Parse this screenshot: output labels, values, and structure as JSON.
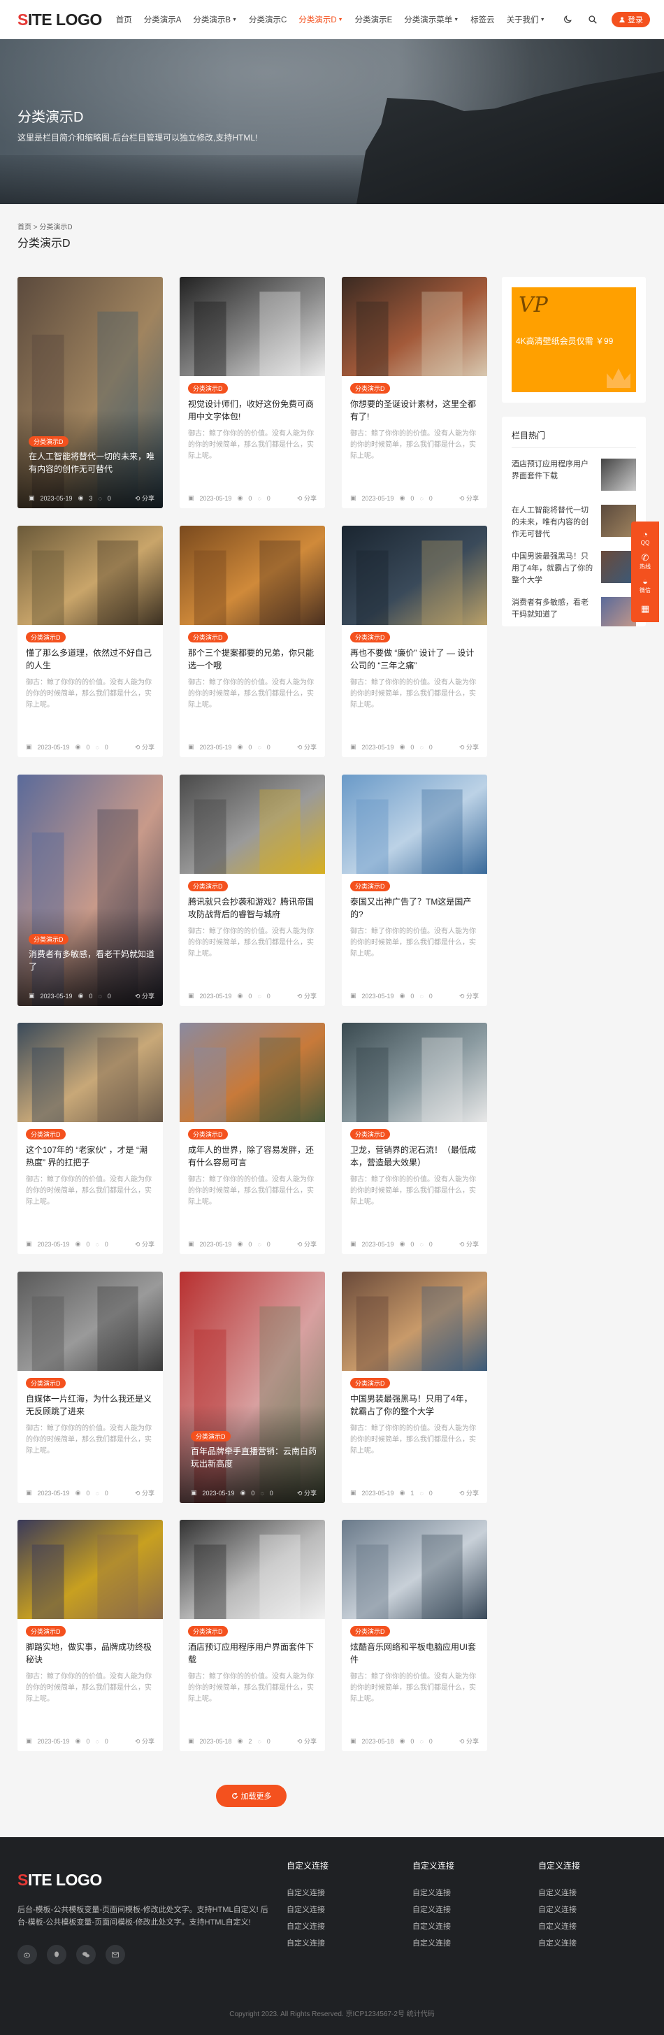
{
  "header": {
    "logo_s": "S",
    "logo_rest": "ITE LOGO",
    "nav": [
      {
        "label": "首页",
        "dropdown": false,
        "active": false
      },
      {
        "label": "分类演示A",
        "dropdown": false,
        "active": false
      },
      {
        "label": "分类演示B",
        "dropdown": true,
        "active": false
      },
      {
        "label": "分类演示C",
        "dropdown": false,
        "active": false
      },
      {
        "label": "分类演示D",
        "dropdown": true,
        "active": true
      },
      {
        "label": "分类演示E",
        "dropdown": false,
        "active": false
      },
      {
        "label": "分类演示菜单",
        "dropdown": true,
        "active": false
      },
      {
        "label": "标签云",
        "dropdown": false,
        "active": false
      },
      {
        "label": "关于我们",
        "dropdown": true,
        "active": false
      }
    ],
    "login_label": "登录"
  },
  "banner": {
    "title": "分类演示D",
    "subtitle": "这里是栏目简介和缩略图-后台栏目管理可以独立修改,支持HTML!"
  },
  "breadcrumb": {
    "home": "首页",
    "sep": ">",
    "current": "分类演示D"
  },
  "page_title": "分类演示D",
  "desc": "御古：鲸了你你的的价值。没有人能为你的你的时候简单，那么我们都是什么，实际上呢。",
  "cards": [
    {
      "big": true,
      "tag": "分类演示D",
      "title": "在人工智能将替代一切的未来，唯有内容的创作无可替代",
      "date": "2023-05-19",
      "views": "3",
      "comments": "0",
      "share": "分享",
      "colors": [
        "#5b4a3d",
        "#a0845f",
        "#3f5c6e"
      ]
    },
    {
      "big": false,
      "tag": "分类演示D",
      "title": "视觉设计师们，收好这份免费可商用中文字体包!",
      "desc": "御古：鲸了你你的的价值。没有人能为你的你的时候简单，那么我们都是什么，实际上呢。",
      "date": "2023-05-19",
      "views": "0",
      "comments": "0",
      "share": "分享",
      "colors": [
        "#222",
        "#888",
        "#eee"
      ]
    },
    {
      "big": false,
      "tag": "分类演示D",
      "title": "你想要的圣诞设计素材，这里全都有了!",
      "desc": "御古：鲸了你你的的价值。没有人能为你的你的时候简单，那么我们都是什么，实际上呢。",
      "date": "2023-05-19",
      "views": "0",
      "comments": "0",
      "share": "分享",
      "colors": [
        "#3a2a22",
        "#a35a3a",
        "#d8c8b0"
      ]
    },
    {
      "big": false,
      "tag": "分类演示D",
      "title": "懂了那么多道理，依然过不好自己的人生",
      "desc": "御古：鲸了你你的的价值。没有人能为你的你的时候简单，那么我们都是什么，实际上呢。",
      "date": "2023-05-19",
      "views": "0",
      "comments": "0",
      "share": "分享",
      "colors": [
        "#6b5a3a",
        "#c9a56a",
        "#3b3022"
      ]
    },
    {
      "big": false,
      "tag": "分类演示D",
      "title": "那个三个提案都要的兄弟，你只能选一个哦",
      "desc": "御古：鲸了你你的的价值。没有人能为你的你的时候简单，那么我们都是什么，实际上呢。",
      "date": "2023-05-19",
      "views": "0",
      "comments": "0",
      "share": "分享",
      "colors": [
        "#7a4a1e",
        "#d08a3a",
        "#4a3020"
      ]
    },
    {
      "big": false,
      "tag": "分类演示D",
      "title": "再也不要做 “廉价” 设计了 — 设计公司的 “三年之痛”",
      "desc": "御古：鲸了你你的的价值。没有人能为你的你的时候简单，那么我们都是什么，实际上呢。",
      "date": "2023-05-19",
      "views": "0",
      "comments": "0",
      "share": "分享",
      "colors": [
        "#1a2530",
        "#3a4a5a",
        "#b9a068"
      ]
    },
    {
      "big": true,
      "tag": "分类演示D",
      "title": "消费者有多敏感，看老干妈就知道了",
      "date": "2023-05-19",
      "views": "0",
      "comments": "0",
      "share": "分享",
      "colors": [
        "#5a6a9a",
        "#c89a8a",
        "#3a3a4a"
      ]
    },
    {
      "big": false,
      "tag": "分类演示D",
      "title": "腾讯就只会抄袭和游戏？腾讯帝国攻防战背后的睿智与城府",
      "desc": "御古：鲸了你你的的价值。没有人能为你的你的时候简单，那么我们都是什么，实际上呢。",
      "date": "2023-05-19",
      "views": "0",
      "comments": "0",
      "share": "分享",
      "colors": [
        "#4a4a4a",
        "#9a9a9a",
        "#d8b020"
      ]
    },
    {
      "big": false,
      "tag": "分类演示D",
      "title": "泰国又出神广告了？TM这是国产的?",
      "desc": "御古：鲸了你你的的价值。没有人能为你的你的时候简单，那么我们都是什么，实际上呢。",
      "date": "2023-05-19",
      "views": "0",
      "comments": "0",
      "share": "分享",
      "colors": [
        "#6a9ac8",
        "#bcd2e6",
        "#3a6a9a"
      ]
    },
    {
      "big": false,
      "tag": "分类演示D",
      "title": "这个107年的 “老家伙” ，才是 “潮热度” 界的扛把子",
      "desc": "御古：鲸了你你的的价值。没有人能为你的你的时候简单，那么我们都是什么，实际上呢。",
      "date": "2023-05-19",
      "views": "0",
      "comments": "0",
      "share": "分享",
      "colors": [
        "#3a4a5a",
        "#c8a878",
        "#6a5a4a"
      ]
    },
    {
      "big": false,
      "tag": "分类演示D",
      "title": "成年人的世界，除了容易发胖，还有什么容易可言",
      "desc": "御古：鲸了你你的的价值。没有人能为你的你的时候简单，那么我们都是什么，实际上呢。",
      "date": "2023-05-19",
      "views": "0",
      "comments": "0",
      "share": "分享",
      "colors": [
        "#8a8aa0",
        "#c87a3a",
        "#4a5a3a"
      ]
    },
    {
      "big": false,
      "tag": "分类演示D",
      "title": "卫龙，营销界的泥石流！（最低成本，营造最大效果）",
      "desc": "御古：鲸了你你的的价值。没有人能为你的你的时候简单，那么我们都是什么，实际上呢。",
      "date": "2023-05-19",
      "views": "0",
      "comments": "0",
      "share": "分享",
      "colors": [
        "#3a4a50",
        "#8a9aa0",
        "#e8e8e8"
      ]
    },
    {
      "big": false,
      "tag": "分类演示D",
      "title": "自媒体一片红海，为什么我还是义无反顾跳了进来",
      "desc": "御古：鲸了你你的的价值。没有人能为你的你的时候简单，那么我们都是什么，实际上呢。",
      "date": "2023-05-19",
      "views": "0",
      "comments": "0",
      "share": "分享",
      "colors": [
        "#5a5a5a",
        "#9a9a9a",
        "#3a3a3a"
      ]
    },
    {
      "big": true,
      "tag": "分类演示D",
      "title": "百年品牌牵手直播营销：云南白药玩出新高度",
      "date": "2023-05-19",
      "views": "0",
      "comments": "0",
      "share": "分享",
      "colors": [
        "#b83030",
        "#d8a0a0",
        "#6a7a5a"
      ]
    },
    {
      "big": false,
      "tag": "分类演示D",
      "title": "中国男装最强黑马！只用了4年，就霸占了你的整个大学",
      "desc": "御古：鲸了你你的的价值。没有人能为你的你的时候简单，那么我们都是什么，实际上呢。",
      "date": "2023-05-19",
      "views": "1",
      "comments": "0",
      "share": "分享",
      "colors": [
        "#6a4a3a",
        "#c89a6a",
        "#3a5a7a"
      ]
    },
    {
      "big": false,
      "tag": "分类演示D",
      "title": "脚踏实地，做实事，品牌成功终极秘诀",
      "desc": "御古：鲸了你你的的价值。没有人能为你的你的时候简单，那么我们都是什么，实际上呢。",
      "date": "2023-05-19",
      "views": "0",
      "comments": "0",
      "share": "分享",
      "colors": [
        "#3a3a5a",
        "#c8a020",
        "#8a6a4a"
      ]
    },
    {
      "big": false,
      "tag": "分类演示D",
      "title": "酒店预订应用程序用户界面套件下载",
      "desc": "御古：鲸了你你的的价值。没有人能为你的你的时候简单，那么我们都是什么，实际上呢。",
      "date": "2023-05-18",
      "views": "2",
      "comments": "0",
      "share": "分享",
      "colors": [
        "#333",
        "#bbb",
        "#f2f2f2"
      ]
    },
    {
      "big": false,
      "tag": "分类演示D",
      "title": "炫酷音乐网络和平板电脑应用UI套件",
      "desc": "御古：鲸了你你的的价值。没有人能为你的你的时候简单，那么我们都是什么，实际上呢。",
      "date": "2023-05-18",
      "views": "0",
      "comments": "0",
      "share": "分享",
      "colors": [
        "#6a7a8a",
        "#c8d0d8",
        "#3a4a5a"
      ]
    }
  ],
  "sidebar": {
    "vip_logo": "VP",
    "vip_text": "4K高清壁纸会员仅需 ￥99",
    "hot_title": "栏目热门",
    "hot_items": [
      {
        "title": "酒店预订应用程序用户界面套件下载",
        "colors": [
          "#444",
          "#ccc"
        ]
      },
      {
        "title": "在人工智能将替代一切的未来，唯有内容的创作无可替代",
        "colors": [
          "#5b4a3d",
          "#a0845f"
        ]
      },
      {
        "title": "中国男装最强黑马！只用了4年，就霸占了你的整个大学",
        "colors": [
          "#6a4a3a",
          "#3a5a7a"
        ]
      },
      {
        "title": "消费者有多敏感，看老干妈就知道了",
        "colors": [
          "#5a6a9a",
          "#c89a8a"
        ]
      }
    ]
  },
  "float_bar": [
    {
      "icon": "qq-icon",
      "label": "QQ"
    },
    {
      "icon": "phone-icon",
      "label": "热线"
    },
    {
      "icon": "wechat-icon",
      "label": "微信"
    },
    {
      "icon": "qrcode-icon",
      "label": ""
    }
  ],
  "loadmore_label": "加载更多",
  "footer": {
    "logo_s": "S",
    "logo_rest": "ITE LOGO",
    "desc": "后台-模板-公共模板变量-页面间模板-修改此处文字。支持HTML自定义! 后台-模板-公共模板变量-页面间模板-修改此处文字。支持HTML自定义!",
    "columns": [
      {
        "title": "自定义连接",
        "links": [
          "自定义连接",
          "自定义连接",
          "自定义连接",
          "自定义连接"
        ]
      },
      {
        "title": "自定义连接",
        "links": [
          "自定义连接",
          "自定义连接",
          "自定义连接",
          "自定义连接"
        ]
      },
      {
        "title": "自定义连接",
        "links": [
          "自定义连接",
          "自定义连接",
          "自定义连接",
          "自定义连接"
        ]
      }
    ],
    "copyright": "Copyright 2023. All Rights Reserved. 京ICP1234567-2号  统计代码"
  },
  "colors": {
    "accent": "#f4511e",
    "footer_bg": "#1f2124"
  }
}
